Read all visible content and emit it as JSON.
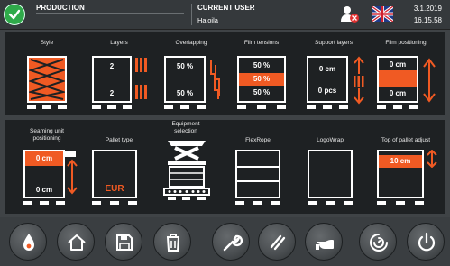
{
  "header": {
    "title": "PRODUCTION",
    "user_label": "CURRENT USER",
    "user_name": "Haloila",
    "date": "3.1.2019",
    "time": "16.15.58",
    "status_color": "#2faa4a"
  },
  "tiles": {
    "style": {
      "label": "Style"
    },
    "layers": {
      "label": "Layers",
      "top": "2",
      "bottom": "2"
    },
    "overlapping": {
      "label": "Overlapping",
      "top": "50 %",
      "bottom": "50 %"
    },
    "film_tensions": {
      "label": "Film tensions",
      "v1": "50 %",
      "v2": "50 %",
      "v3": "50 %"
    },
    "support_layers": {
      "label": "Support layers",
      "top": "0 cm",
      "bottom": "0 pcs"
    },
    "film_positioning": {
      "label": "Film positioning",
      "top": "0 cm",
      "bottom": "0 cm"
    },
    "seaming_unit": {
      "label": "Seaming unit positioning",
      "top": "0 cm",
      "bottom": "0 cm"
    },
    "pallet_type": {
      "label": "Pallet type",
      "value": "EUR"
    },
    "equipment": {
      "label": "Equipment selection"
    },
    "flexrope": {
      "label": "FlexRope"
    },
    "logowrap": {
      "label": "LogoWrap"
    },
    "top_adjust": {
      "label": "Top of pallet adjust",
      "value": "10 cm"
    }
  },
  "toolbar": {
    "buttons": [
      "operator-mode",
      "home",
      "save",
      "delete",
      "tools",
      "film-cut",
      "hand-mode",
      "film-feed",
      "power"
    ]
  },
  "accent_color": "#f05a23"
}
